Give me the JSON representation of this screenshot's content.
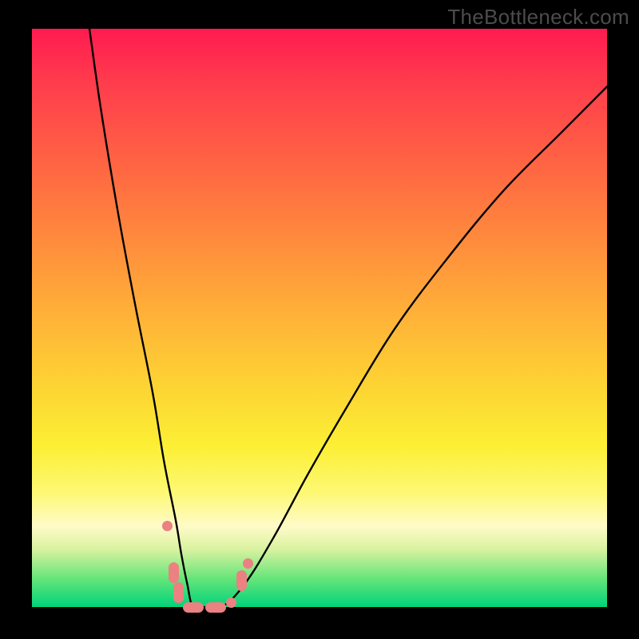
{
  "watermark": "TheBottleneck.com",
  "chart_data": {
    "type": "line",
    "title": "",
    "xlabel": "",
    "ylabel": "",
    "xlim": [
      0,
      100
    ],
    "ylim": [
      0,
      100
    ],
    "series": [
      {
        "name": "curve",
        "x": [
          10,
          12,
          15,
          18,
          21,
          23,
          25,
          26,
          27,
          28,
          30,
          33,
          37,
          42,
          48,
          55,
          63,
          72,
          82,
          92,
          100
        ],
        "y": [
          100,
          86,
          68,
          52,
          37,
          25,
          15,
          9,
          4,
          0,
          0,
          0,
          4,
          12,
          23,
          35,
          48,
          60,
          72,
          82,
          90
        ]
      }
    ],
    "markers": [
      {
        "x": 23.5,
        "y": 14,
        "shape": "dot"
      },
      {
        "x": 24.7,
        "y": 6,
        "shape": "pill-v"
      },
      {
        "x": 25.5,
        "y": 2.5,
        "shape": "pill-v"
      },
      {
        "x": 28.0,
        "y": 0,
        "shape": "pill-h"
      },
      {
        "x": 32.0,
        "y": 0,
        "shape": "pill-h"
      },
      {
        "x": 34.6,
        "y": 0.8,
        "shape": "dot"
      },
      {
        "x": 36.5,
        "y": 4.5,
        "shape": "pill-v"
      },
      {
        "x": 37.6,
        "y": 7.5,
        "shape": "dot"
      }
    ],
    "gradient_note": "background encodes severity: red (top) → green (bottom)"
  }
}
